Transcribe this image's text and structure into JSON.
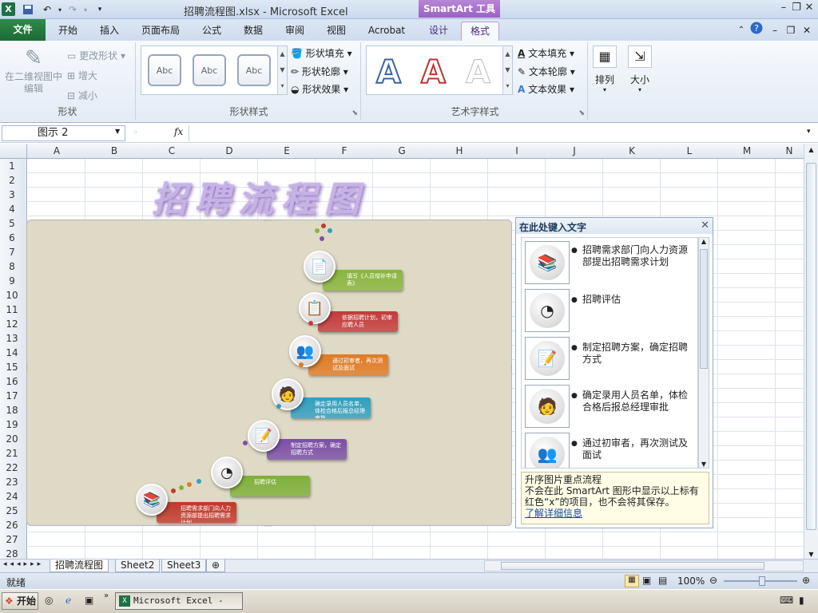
{
  "window": {
    "title": "招聘流程图.xlsx  -  Microsoft Excel",
    "context_tab": "SmartArt 工具"
  },
  "ribbon_tabs": [
    "文件",
    "开始",
    "插入",
    "页面布局",
    "公式",
    "数据",
    "审阅",
    "视图",
    "Acrobat",
    "设计",
    "格式"
  ],
  "groups": {
    "shape": {
      "label": "形状",
      "edit_2d": "在二维视图中编辑",
      "change_shape": "更改形状",
      "larger": "增大",
      "smaller": "减小"
    },
    "shape_styles": {
      "label": "形状样式",
      "gallery": [
        "Abc",
        "Abc",
        "Abc"
      ],
      "fill": "形状填充",
      "outline": "形状轮廓",
      "effect": "形状效果"
    },
    "wordart": {
      "label": "艺术字样式",
      "letters": [
        "A",
        "A",
        "A"
      ],
      "text_fill": "文本填充",
      "text_outline": "文本轮廓",
      "text_effect": "文本效果"
    },
    "arrange": "排列",
    "size": "大小"
  },
  "formula_bar": {
    "name_box": "图示 2",
    "fx": "fx",
    "value": ""
  },
  "columns": [
    "A",
    "B",
    "C",
    "D",
    "E",
    "F",
    "G",
    "H",
    "I",
    "J",
    "K",
    "L",
    "M",
    "N"
  ],
  "rows": [
    "1",
    "2",
    "3",
    "4",
    "5",
    "6",
    "7",
    "8",
    "9",
    "10",
    "11",
    "12",
    "13",
    "14",
    "15",
    "16",
    "17",
    "18",
    "19",
    "20",
    "21",
    "22",
    "23",
    "24",
    "25",
    "26",
    "27",
    "28"
  ],
  "art_title": "招聘流程图",
  "smartart_steps": [
    {
      "text": "招聘需求部门向人力资源部提出招聘需求计划",
      "color": "#c0392b"
    },
    {
      "text": "招聘评估",
      "color": "#7fb03a"
    },
    {
      "text": "制定招聘方案，确定招聘方式",
      "color": "#7a4fa8"
    },
    {
      "text": "确定录用人员名单，体检合格后报总经理审批",
      "color": "#2f9fbf"
    },
    {
      "text": "通过初审者，再次测试及面试",
      "color": "#e07b26"
    },
    {
      "text": "依据招聘计划，初审应聘人员",
      "color": "#c43a3a"
    },
    {
      "text": "填写《人员增补申请表》",
      "color": "#8ab53e"
    }
  ],
  "text_pane": {
    "title": "在此处键入文字",
    "items": [
      "招聘需求部门向人力资源部提出招聘需求计划",
      "招聘评估",
      "制定招聘方案，确定招聘方式",
      "确定录用人员名单，体检合格后报总经理审批",
      "通过初审者，再次测试及面试"
    ],
    "info_title": "升序图片重点流程",
    "info_text": "不会在此 SmartArt 图形中显示以上标有红色“x”的项目，也不会将其保存。",
    "info_link": "了解详细信息"
  },
  "sheets": [
    "招聘流程图",
    "Sheet2",
    "Sheet3"
  ],
  "status": {
    "ready": "就绪",
    "zoom": "100%"
  },
  "taskbar": {
    "start": "开始",
    "task": "Microsoft Excel - ..."
  },
  "colors": {
    "file_tab": "#1e7145",
    "context_tab": "#9a62c4",
    "title_art": "#c5b3e6"
  }
}
